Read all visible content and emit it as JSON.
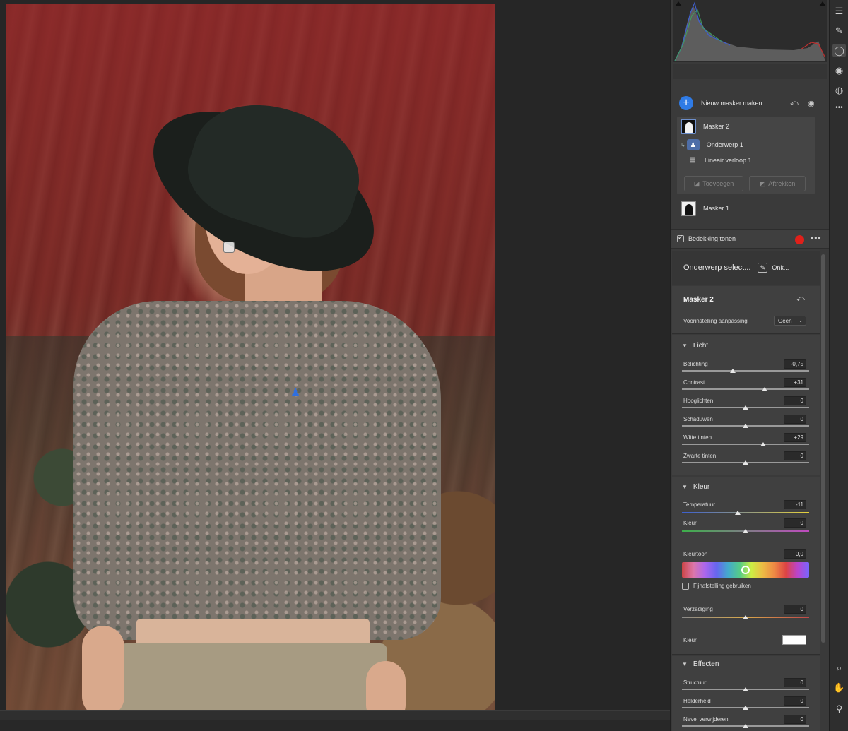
{
  "masks": {
    "new_mask_label": "Nieuw masker maken",
    "items": [
      {
        "name": "Masker 2"
      },
      {
        "name": "Onderwerp 1"
      },
      {
        "name": "Lineair verloop 1"
      }
    ],
    "add_label": "Toevoegen",
    "subtract_label": "Aftrekken",
    "mask1_name": "Masker 1",
    "overlay_label": "Bedekking tonen",
    "overlay_color": "#e0201a"
  },
  "editor": {
    "subject_select_label": "Onderwerp select...",
    "subject_select_extra": "Onk...",
    "mask_title": "Masker 2",
    "preset_label": "Voorinstelling aanpassing",
    "preset_value": "Geen",
    "light": {
      "title": "Licht",
      "sliders": [
        {
          "label": "Belichting",
          "value": "-0,75",
          "pos": 0.4
        },
        {
          "label": "Contrast",
          "value": "+31",
          "pos": 0.65
        },
        {
          "label": "Hooglichten",
          "value": "0",
          "pos": 0.5
        },
        {
          "label": "Schaduwen",
          "value": "0",
          "pos": 0.5
        },
        {
          "label": "Witte tinten",
          "value": "+29",
          "pos": 0.64
        },
        {
          "label": "Zwarte tinten",
          "value": "0",
          "pos": 0.5
        }
      ]
    },
    "color": {
      "title": "Kleur",
      "temperature_label": "Temperatuur",
      "temperature_value": "-11",
      "temperature_pos": 0.44,
      "tint_label": "Kleur",
      "tint_value": "0",
      "tint_pos": 0.5,
      "hue_label": "Kleurtoon",
      "hue_value": "0,0",
      "hue_pos": 0.5,
      "fine_tune_label": "Fijnafstelling gebruiken",
      "saturation_label": "Verzadiging",
      "saturation_value": "0",
      "saturation_pos": 0.5,
      "color_label": "Kleur"
    },
    "effects": {
      "title": "Effecten",
      "sliders": [
        {
          "label": "Structuur",
          "value": "0",
          "pos": 0.5
        },
        {
          "label": "Helderheid",
          "value": "0",
          "pos": 0.5
        },
        {
          "label": "Nevel verwijderen",
          "value": "0",
          "pos": 0.5
        }
      ]
    }
  },
  "toolbar": {
    "tools": [
      "sliders-icon",
      "brush-icon",
      "mask-icon",
      "redeye-icon",
      "presets-icon",
      "more-icon"
    ],
    "bottom_tools": [
      "zoom-icon",
      "hand-icon",
      "sampler-icon"
    ]
  }
}
